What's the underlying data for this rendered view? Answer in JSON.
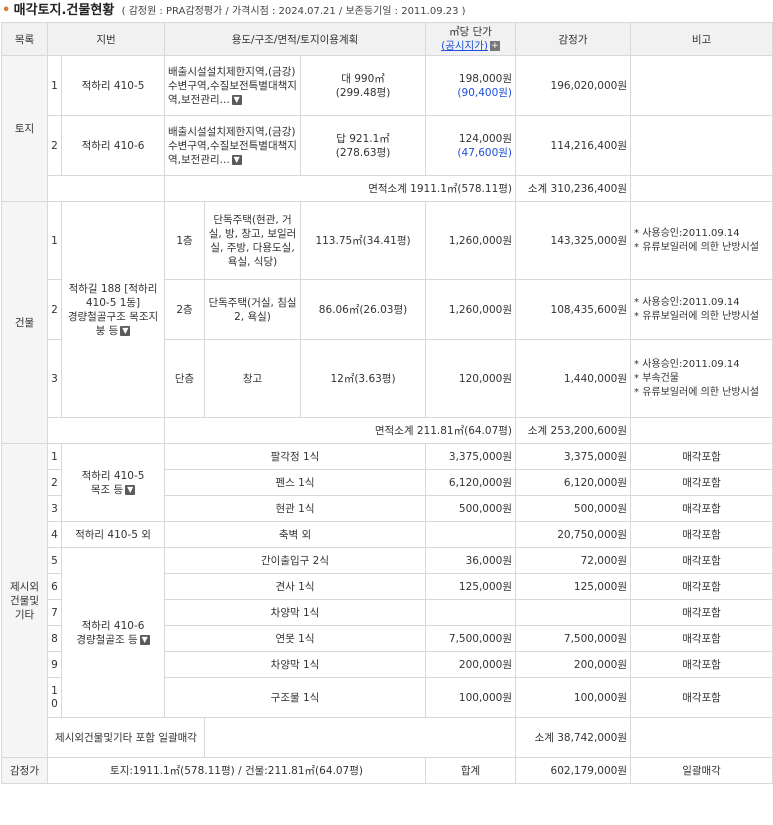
{
  "header": {
    "bullet": "•",
    "title": "매각토지.건물현황",
    "subtitle": "( 감정원 : PRA감정평가 / 가격시점 : 2024.07.21 / 보존등기일 : 2011.09.23 )"
  },
  "columns": {
    "category": "목록",
    "lot": "지번",
    "use": "용도/구조/면적/토지이용계획",
    "unit_price": "㎡당 단가",
    "unit_price_link": "(공시지가)",
    "appraisal": "감정가",
    "remarks": "비고"
  },
  "land": {
    "label": "토지",
    "rows": [
      {
        "no": "1",
        "lot": "적하리 410-5",
        "plan": "배출시설설치제한지역,(금강)수변구역,수질보전특별대책지역,보전관리...",
        "area": "대 990㎡",
        "area_py": "(299.48평)",
        "price": "198,000원",
        "official": "(90,400원)",
        "appraisal": "196,020,000원"
      },
      {
        "no": "2",
        "lot": "적하리 410-6",
        "plan": "배출시설설치제한지역,(금강)수변구역,수질보전특별대책지역,보전관리...",
        "area": "답 921.1㎡",
        "area_py": "(278.63평)",
        "price": "124,000원",
        "official": "(47,600원)",
        "appraisal": "114,216,400원"
      }
    ],
    "area_subtotal": "면적소계 1911.1㎡(578.11평)",
    "subtotal": "소계 310,236,400원"
  },
  "building": {
    "label": "건물",
    "lot": "적하길 188 [적하리 410-5 1동]",
    "structure": "경량철골구조 목조지붕 등",
    "rows": [
      {
        "no": "1",
        "floor": "1층",
        "use": "단독주택(현관, 거실, 방, 창고, 보일러실, 주방, 다용도실, 욕실, 식당)",
        "area": "113.75㎡(34.41평)",
        "price": "1,260,000원",
        "appraisal": "143,325,000원",
        "note1": "* 사용승인:2011.09.14",
        "note2": "* 유류보일러에 의한 난방시설"
      },
      {
        "no": "2",
        "floor": "2층",
        "use": "단독주택(거실, 침실 2, 욕실)",
        "area": "86.06㎡(26.03평)",
        "price": "1,260,000원",
        "appraisal": "108,435,600원",
        "note1": "* 사용승인:2011.09.14",
        "note2": "* 유류보일러에 의한 난방시설"
      },
      {
        "no": "3",
        "floor": "단층",
        "use": "창고",
        "area": "12㎡(3.63평)",
        "price": "120,000원",
        "appraisal": "1,440,000원",
        "note1": "* 사용승인:2011.09.14",
        "note2": "* 부속건물",
        "note3": "* 유류보일러에 의한 난방시설"
      }
    ],
    "area_subtotal": "면적소계 211.81㎡(64.07평)",
    "subtotal": "소계 253,200,600원"
  },
  "other": {
    "label": "제시외 건물및 기타",
    "lot_a": "적하리 410-5",
    "lot_a_struct": "목조 등",
    "lot_c": "적하리 410-6",
    "lot_c_struct": "경량철골조 등",
    "rows": [
      {
        "no": "1",
        "use": "팔각정 1식",
        "price": "3,375,000원",
        "appraisal": "3,375,000원",
        "remark": "매각포함"
      },
      {
        "no": "2",
        "use": "펜스 1식",
        "price": "6,120,000원",
        "appraisal": "6,120,000원",
        "remark": "매각포함"
      },
      {
        "no": "3",
        "use": "현관 1식",
        "price": "500,000원",
        "appraisal": "500,000원",
        "remark": "매각포함"
      },
      {
        "no": "4",
        "lot": "적하리 410-5 외",
        "use": "축벽 외",
        "price": "",
        "appraisal": "20,750,000원",
        "remark": "매각포함"
      },
      {
        "no": "5",
        "use": "간이출입구 2식",
        "price": "36,000원",
        "appraisal": "72,000원",
        "remark": "매각포함"
      },
      {
        "no": "6",
        "use": "견사 1식",
        "price": "125,000원",
        "appraisal": "125,000원",
        "remark": "매각포함"
      },
      {
        "no": "7",
        "use": "차양막 1식",
        "price": "",
        "appraisal": "",
        "remark": "매각포함"
      },
      {
        "no": "8",
        "use": "연못 1식",
        "price": "7,500,000원",
        "appraisal": "7,500,000원",
        "remark": "매각포함"
      },
      {
        "no": "9",
        "use": "차양막 1식",
        "price": "200,000원",
        "appraisal": "200,000원",
        "remark": "매각포함"
      },
      {
        "no": "10",
        "use": "구조물 1식",
        "price": "100,000원",
        "appraisal": "100,000원",
        "remark": "매각포함"
      }
    ],
    "included_note": "제시외건물및기타 포함 일괄매각",
    "subtotal": "소계 38,742,000원"
  },
  "total": {
    "label": "감정가",
    "area_summary": "토지:1911.1㎡(578.11평) / 건물:211.81㎡(64.07평)",
    "sum_label": "합계",
    "sum": "602,179,000원",
    "remark": "일괄매각"
  },
  "icons": {
    "dropdown": "chevron-down-icon",
    "plus": "plus-icon"
  },
  "colors": {
    "bullet": "#e07b2a",
    "link": "#1e4fd8",
    "header_bg": "#f1f1f1",
    "section_bg": "#f5f5f5"
  }
}
